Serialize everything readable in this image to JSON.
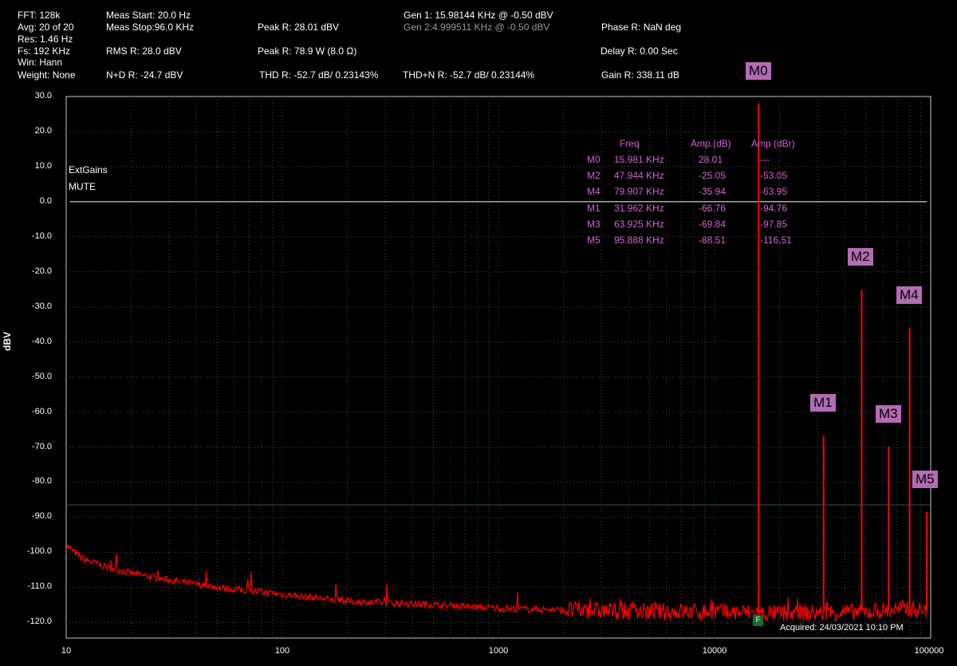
{
  "header": {
    "fft": "FFT: 128k",
    "avg": "Avg: 20 of 20",
    "res": "Res: 1.46 Hz",
    "fs": "Fs: 192 KHz",
    "win": "Win: Hann",
    "weight": "Weight: None",
    "meas_start": "Meas Start: 20.0 Hz",
    "meas_stop": "Meas Stop:96.0 KHz",
    "rms": "RMS R: 28.0 dBV",
    "nd": "N+D R: -24.7 dBV",
    "peak_db": "Peak R: 28.01 dBV",
    "peak_w": "Peak R: 78.9 W (8.0 Ω)",
    "thd": "THD R: -52.7 dB/ 0.23143%",
    "gen1": "Gen 1: 15.98144 KHz @ -0.50  dBV",
    "gen2": "Gen 2:4.999511 KHz @ -0.50  dBV",
    "thdn": "THD+N R: -52.7 dB/ 0.23144%",
    "phase": "Phase R: NaN deg",
    "delay": "Delay R: 0.00 Sec",
    "gain": "Gain R: 338.11 dB"
  },
  "notes": {
    "line1": "ExtGains",
    "line2": "MUTE"
  },
  "acquired": "Acquired: 24/03/2021  10:10 PM",
  "f_marker": "F",
  "marker_table": {
    "headers": [
      "Freq",
      "Amp.(dB)",
      "Amp (dBr)"
    ],
    "rows": [
      {
        "id": "M0",
        "freq": "15.981 KHz",
        "amp_db": "28.01",
        "amp_dbr": "---"
      },
      {
        "id": "M2",
        "freq": "47.944 KHz",
        "amp_db": "-25.05",
        "amp_dbr": "-53.05"
      },
      {
        "id": "M4",
        "freq": "79.907 KHz",
        "amp_db": "-35.94",
        "amp_dbr": "-63.95"
      },
      {
        "id": "M1",
        "freq": "31.962 KHz",
        "amp_db": "-66.76",
        "amp_dbr": "-94.76"
      },
      {
        "id": "M3",
        "freq": "63.925 KHz",
        "amp_db": "-69.84",
        "amp_dbr": "-97.85"
      },
      {
        "id": "M5",
        "freq": "95.888 KHz",
        "amp_db": "-88.51",
        "amp_dbr": "-116.51"
      }
    ]
  },
  "colors": {
    "trace": "#ff0000",
    "marker_tag": "#b36cb3",
    "table_text": "#cc66cc",
    "reference_line": "#ffffff",
    "threshold_line": "#2e5a2e",
    "grid": "#4a4a4a"
  },
  "chart_data": {
    "type": "line",
    "xlabel": "",
    "ylabel": "dBV",
    "x_scale": "log",
    "xlim": [
      10,
      100000
    ],
    "ylim": [
      -125,
      30
    ],
    "x_ticks": [
      "10",
      "100",
      "1000",
      "10000",
      "100000"
    ],
    "y_ticks": [
      "30.0",
      "20.0",
      "10.0",
      "0.0",
      "-10.0",
      "-20.0",
      "-30.0",
      "-40.0",
      "-50.0",
      "-60.0",
      "-70.0",
      "-80.0",
      "-90.0",
      "-100.0",
      "-110.0",
      "-120.0"
    ],
    "grid": true,
    "reference_line_y": 0,
    "threshold_line_y": -86.5,
    "noise_floor": {
      "x": [
        10,
        12,
        15,
        20,
        30,
        50,
        100,
        200,
        500,
        1000,
        2000,
        5000,
        10000,
        20000,
        50000,
        80000,
        96000
      ],
      "y": [
        -98,
        -102,
        -104,
        -106,
        -108,
        -110,
        -112,
        -114,
        -115,
        -116,
        -116.5,
        -117,
        -117,
        -117.5,
        -117,
        -116,
        -117
      ]
    },
    "markers": [
      {
        "label": "M0",
        "freq": 15981,
        "amp": 28.01
      },
      {
        "label": "M1",
        "freq": 31962,
        "amp": -66.76
      },
      {
        "label": "M2",
        "freq": 47944,
        "amp": -25.05
      },
      {
        "label": "M3",
        "freq": 63925,
        "amp": -69.84
      },
      {
        "label": "M4",
        "freq": 79907,
        "amp": -35.94
      },
      {
        "label": "M5",
        "freq": 95888,
        "amp": -88.51
      }
    ]
  }
}
